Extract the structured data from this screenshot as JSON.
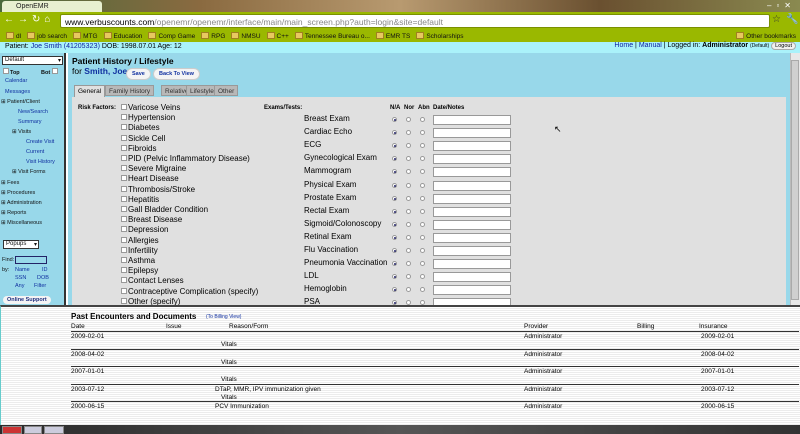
{
  "browser": {
    "tab_title": "OpenEMR",
    "url_domain": "www.verbuscounts.com",
    "url_path": "/openemr/openemr/interface/main/main_screen.php?auth=login&site=default",
    "bookmarks": [
      "dl",
      "job search",
      "MTG",
      "Education",
      "Comp Game",
      "RPG",
      "NMSU",
      "C++",
      "Tennessee Bureau o...",
      "EMR TS",
      "Scholarships"
    ],
    "other_bookmarks": "Other bookmarks"
  },
  "header": {
    "patient_label": "Patient:",
    "patient_link": "Joe Smith (4120532З)",
    "dob": "DOB: 1998.07.01 Age: 12",
    "home": "Home",
    "manual": "Manual",
    "logged_in": "| Logged in:",
    "user": "Administrator",
    "site": "(Default)",
    "logout": "Logout"
  },
  "sidebar": {
    "frame_select": "Default",
    "top": "Top",
    "bot": "Bot",
    "items": [
      "Calendar",
      "Messages",
      "Patient/Client",
      "New/Search",
      "Summary",
      "Visits",
      "Create Visit",
      "Current",
      "Visit History",
      "Visit Forms",
      "Fees",
      "Procedures",
      "Administration",
      "Reports",
      "Miscellaneous"
    ],
    "popups": "Popups",
    "find": "Find:",
    "by": "by:",
    "find_links": [
      "Name",
      "ID",
      "SSN",
      "DOB",
      "Any",
      "Filter"
    ],
    "online_support": "Online Support"
  },
  "page": {
    "title": "Patient History / Lifestyle",
    "for": "for",
    "patient": "Smith, Joe",
    "save": "Save",
    "back": "Back To View",
    "tabs": [
      "General",
      "Family History",
      "Relatives",
      "Lifestyle",
      "Other"
    ],
    "risk_label": "Risk Factors:",
    "risk_factors": [
      "Varicose Veins",
      "Hypertension",
      "Diabetes",
      "Sickle Cell",
      "Fibroids",
      "PID (Pelvic Inflammatory Disease)",
      "Severe Migraine",
      "Heart Disease",
      "Thrombosis/Stroke",
      "Hepatitis",
      "Gall Bladder Condition",
      "Breast Disease",
      "Depression",
      "Allergies",
      "Infertility",
      "Asthma",
      "Epilepsy",
      "Contact Lenses",
      "Contraceptive Complication (specify)",
      "Other (specify)"
    ],
    "exams_label": "Exams/Tests:",
    "col_na": "N/A",
    "col_nor": "Nor",
    "col_abn": "Abn",
    "col_notes": "Date/Notes",
    "exams": [
      "Breast Exam",
      "Cardiac Echo",
      "ECG",
      "Gynecological Exam",
      "Mammogram",
      "Physical Exam",
      "Prostate Exam",
      "Rectal Exam",
      "Sigmoid/Colonoscopy",
      "Retinal Exam",
      "Flu Vaccination",
      "Pneumonia Vaccination",
      "LDL",
      "Hemoglobin",
      "PSA"
    ]
  },
  "encounters": {
    "title": "Past Encounters and Documents",
    "billing_view": "(To Billing View)",
    "headers": [
      "Date",
      "Issue",
      "Reason/Form",
      "Provider",
      "Billing",
      "Insurance"
    ],
    "rows": [
      {
        "date": "2009-02-01",
        "reason": "",
        "form": "Vitals",
        "provider": "Administrator",
        "insurance": "2009-02-01"
      },
      {
        "date": "2008-04-02",
        "reason": "",
        "form": "Vitals",
        "provider": "Administrator",
        "insurance": "2008-04-02"
      },
      {
        "date": "2007-01-01",
        "reason": "",
        "form": "Vitals",
        "provider": "Administrator",
        "insurance": "2007-01-01"
      },
      {
        "date": "2003-07-12",
        "reason": "DTaP, MMR, IPV immunization given",
        "form": "Vitals",
        "provider": "Administrator",
        "insurance": "2003-07-12"
      },
      {
        "date": "2000-06-15",
        "reason": "PCV Immunization",
        "form": "",
        "provider": "Administrator",
        "insurance": "2000-06-15"
      }
    ]
  }
}
